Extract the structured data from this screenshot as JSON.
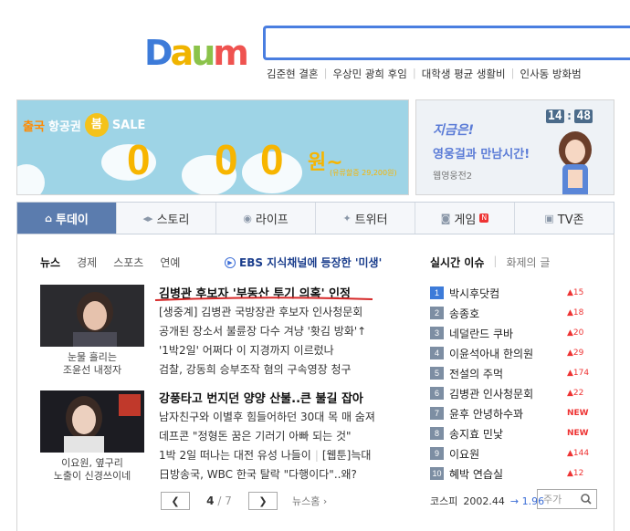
{
  "header": {
    "logo_letters": [
      {
        "char": "D",
        "color": "#3d7bd9"
      },
      {
        "char": "a",
        "color": "#f0b400"
      },
      {
        "char": "u",
        "color": "#8bc34a"
      },
      {
        "char": "m",
        "color": "#ef5350"
      }
    ],
    "search_value": "",
    "trends": [
      "김준현 결혼",
      "우상민 광희 후임",
      "대학생 평균 생활비",
      "인사동 방화범"
    ]
  },
  "banner_left": {
    "prefix": "출국",
    "text": "항공권",
    "badge": "봄",
    "sale": "SALE",
    "digits": [
      "0",
      "0",
      "0"
    ],
    "won": "원~",
    "note": "(유류할증 29,200원)"
  },
  "banner_right": {
    "clock": [
      "14",
      "48"
    ],
    "now_label": "지금은!",
    "title": "영웅걸과 만남시간!",
    "subtitle": "웹영웅전2"
  },
  "nav_tabs": [
    {
      "label": "투데이",
      "icon": "home-icon",
      "active": true
    },
    {
      "label": "스토리",
      "icon": "story-icon",
      "active": false
    },
    {
      "label": "라이프",
      "icon": "eye-icon",
      "active": false
    },
    {
      "label": "트위터",
      "icon": "twitter-icon",
      "active": false
    },
    {
      "label": "게임",
      "icon": "gamepad-icon",
      "active": false,
      "badge": "N"
    },
    {
      "label": "TV존",
      "icon": "tv-icon",
      "active": false
    }
  ],
  "news": {
    "subtabs": [
      "뉴스",
      "경제",
      "스포츠",
      "연예"
    ],
    "headline_link": "EBS 지식채널에 등장한 '미생'",
    "stories": [
      {
        "caption": [
          "눈물 흘리는",
          "조윤선 내정자"
        ],
        "title": "김병관 후보자 '부동산 투기 의혹' 인정",
        "lines": [
          "[생중계] 김병관 국방장관 후보자 인사청문회",
          "공개된 장소서 불륜장 다수 겨냥 '홧김 방화'↑",
          "'1박2일' 어쩌다 이 지경까지 이르렀나",
          "검찰, 강동희 승부조작 혐의 구속영장 청구"
        ]
      },
      {
        "caption": [
          "이요원, 옆구리",
          "노출이 신경쓰이네"
        ],
        "title": "강풍타고 번지던 양양 산불..큰 불길 잡아",
        "lines": [
          "남자친구와 이별후 힘들어하던 30대 목 매 숨져",
          "데프콘 \"정형돈 꿈은 기러기 아빠 되는 것\""
        ],
        "split_lines": [
          [
            "1박 2일 떠나는 대전 유성 나들이",
            "[웹툰]늑대"
          ],
          [
            "日방송국, WBC 한국 탈락 \"다행이다\"..왜?"
          ]
        ]
      }
    ],
    "pager": {
      "current": "4",
      "total": "/ 7",
      "more": "뉴스홈"
    }
  },
  "realtime": {
    "tabs": [
      "실시간 이슈",
      "화제의 글"
    ],
    "items": [
      {
        "rank": "1",
        "text": "박시후닷컴",
        "change": "15",
        "new": false
      },
      {
        "rank": "2",
        "text": "송종호",
        "change": "18",
        "new": false
      },
      {
        "rank": "3",
        "text": "네덜란드 쿠바",
        "change": "20",
        "new": false
      },
      {
        "rank": "4",
        "text": "이윤석아내 한의원",
        "change": "29",
        "new": false
      },
      {
        "rank": "5",
        "text": "전설의 주먹",
        "change": "174",
        "new": false
      },
      {
        "rank": "6",
        "text": "김병관 인사청문회",
        "change": "22",
        "new": false
      },
      {
        "rank": "7",
        "text": "윤후 안녕하수꽈",
        "change": "NEW",
        "new": true
      },
      {
        "rank": "8",
        "text": "송지효 민낯",
        "change": "NEW",
        "new": true
      },
      {
        "rank": "9",
        "text": "이요원",
        "change": "144",
        "new": false
      },
      {
        "rank": "10",
        "text": "혜박 연습실",
        "change": "12",
        "new": false
      }
    ],
    "stock": {
      "label": "코스피",
      "value": "2002.44",
      "change": "1.96",
      "search_placeholder": "주가"
    }
  }
}
